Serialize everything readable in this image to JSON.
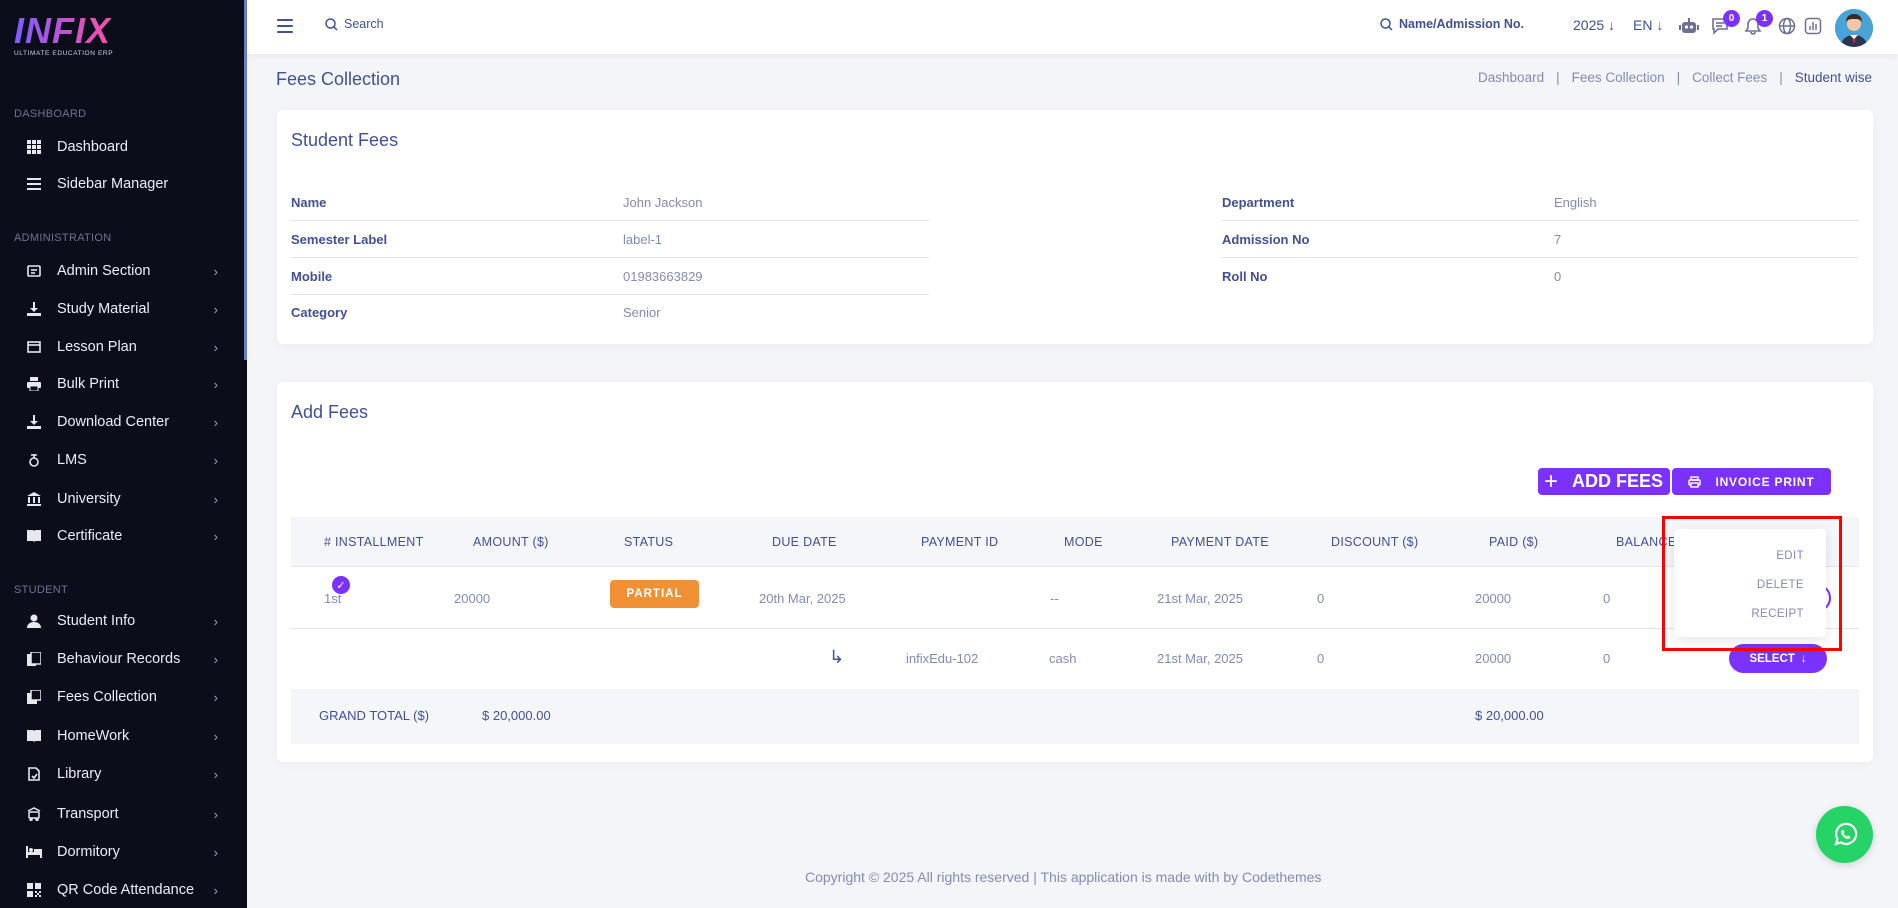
{
  "brand": {
    "logo_text": "INFIX",
    "tagline": "ULTIMATE EDUCATION ERP"
  },
  "sidebar": {
    "sections": [
      {
        "label": "DASHBOARD"
      },
      {
        "label": "ADMINISTRATION"
      },
      {
        "label": "STUDENT"
      }
    ],
    "items": [
      {
        "label": "Dashboard",
        "icon": "grid-icon"
      },
      {
        "label": "Sidebar Manager",
        "icon": "menu-icon"
      },
      {
        "label": "Admin Section",
        "icon": "admin-icon"
      },
      {
        "label": "Study Material",
        "icon": "download-icon"
      },
      {
        "label": "Lesson Plan",
        "icon": "list-icon"
      },
      {
        "label": "Bulk Print",
        "icon": "printer-icon"
      },
      {
        "label": "Download Center",
        "icon": "download-icon"
      },
      {
        "label": "LMS",
        "icon": "lms-icon"
      },
      {
        "label": "University",
        "icon": "bank-icon"
      },
      {
        "label": "Certificate",
        "icon": "book-icon"
      },
      {
        "label": "Student Info",
        "icon": "user-icon"
      },
      {
        "label": "Behaviour Records",
        "icon": "file-icon"
      },
      {
        "label": "Fees Collection",
        "icon": "money-icon"
      },
      {
        "label": "HomeWork",
        "icon": "book-icon"
      },
      {
        "label": "Library",
        "icon": "library-icon"
      },
      {
        "label": "Transport",
        "icon": "bus-icon"
      },
      {
        "label": "Dormitory",
        "icon": "bed-icon"
      },
      {
        "label": "QR Code Attendance",
        "icon": "qr-icon"
      }
    ]
  },
  "header": {
    "search_placeholder": "Search",
    "admission_search": "Name/Admission No.",
    "year": "2025",
    "lang": "EN",
    "chat_badge": "0",
    "notification_badge": "1"
  },
  "page": {
    "title": "Fees Collection",
    "breadcrumb": [
      "Dashboard",
      "Fees Collection",
      "Collect Fees",
      "Student wise"
    ]
  },
  "student_fees": {
    "title": "Student Fees",
    "left": [
      {
        "key": "Name",
        "value": "John Jackson"
      },
      {
        "key": "Semester Label",
        "value": "label-1"
      },
      {
        "key": "Mobile",
        "value": "01983663829"
      },
      {
        "key": "Category",
        "value": "Senior"
      }
    ],
    "right": [
      {
        "key": "Department",
        "value": "English"
      },
      {
        "key": "Admission No",
        "value": "7"
      },
      {
        "key": "Roll No",
        "value": "0"
      }
    ]
  },
  "add_fees": {
    "title": "Add Fees",
    "add_button": "ADD FEES",
    "print_button": "INVOICE PRINT",
    "columns": [
      "# INSTALLMENT",
      "AMOUNT ($)",
      "STATUS",
      "DUE DATE",
      "PAYMENT ID",
      "MODE",
      "PAYMENT DATE",
      "DISCOUNT ($)",
      "PAID ($)",
      "BALANCE"
    ],
    "row1": {
      "installment": "1st",
      "amount": "20000",
      "status": "PARTIAL",
      "due_date": "20th Mar, 2025",
      "payment_id": "",
      "mode": "--",
      "payment_date": "21st Mar, 2025",
      "discount": "0",
      "paid": "20000",
      "balance": "0"
    },
    "row2": {
      "payment_id": "infixEdu-102",
      "mode": "cash",
      "payment_date": "21st Mar, 2025",
      "discount": "0",
      "paid": "20000",
      "balance": "0",
      "select_label": "SELECT"
    },
    "total": {
      "label": "GRAND TOTAL ($)",
      "amount": "$ 20,000.00",
      "paid": "$ 20,000.00"
    },
    "dropdown": [
      "EDIT",
      "DELETE",
      "RECEIPT"
    ]
  },
  "footer": {
    "text": "Copyright © 2025 All rights reserved | This application is made with by Codethemes"
  },
  "colors": {
    "accent": "#7c32ff",
    "status_partial": "#f09136",
    "highlight": "#ff0000",
    "whatsapp": "#25d366"
  }
}
